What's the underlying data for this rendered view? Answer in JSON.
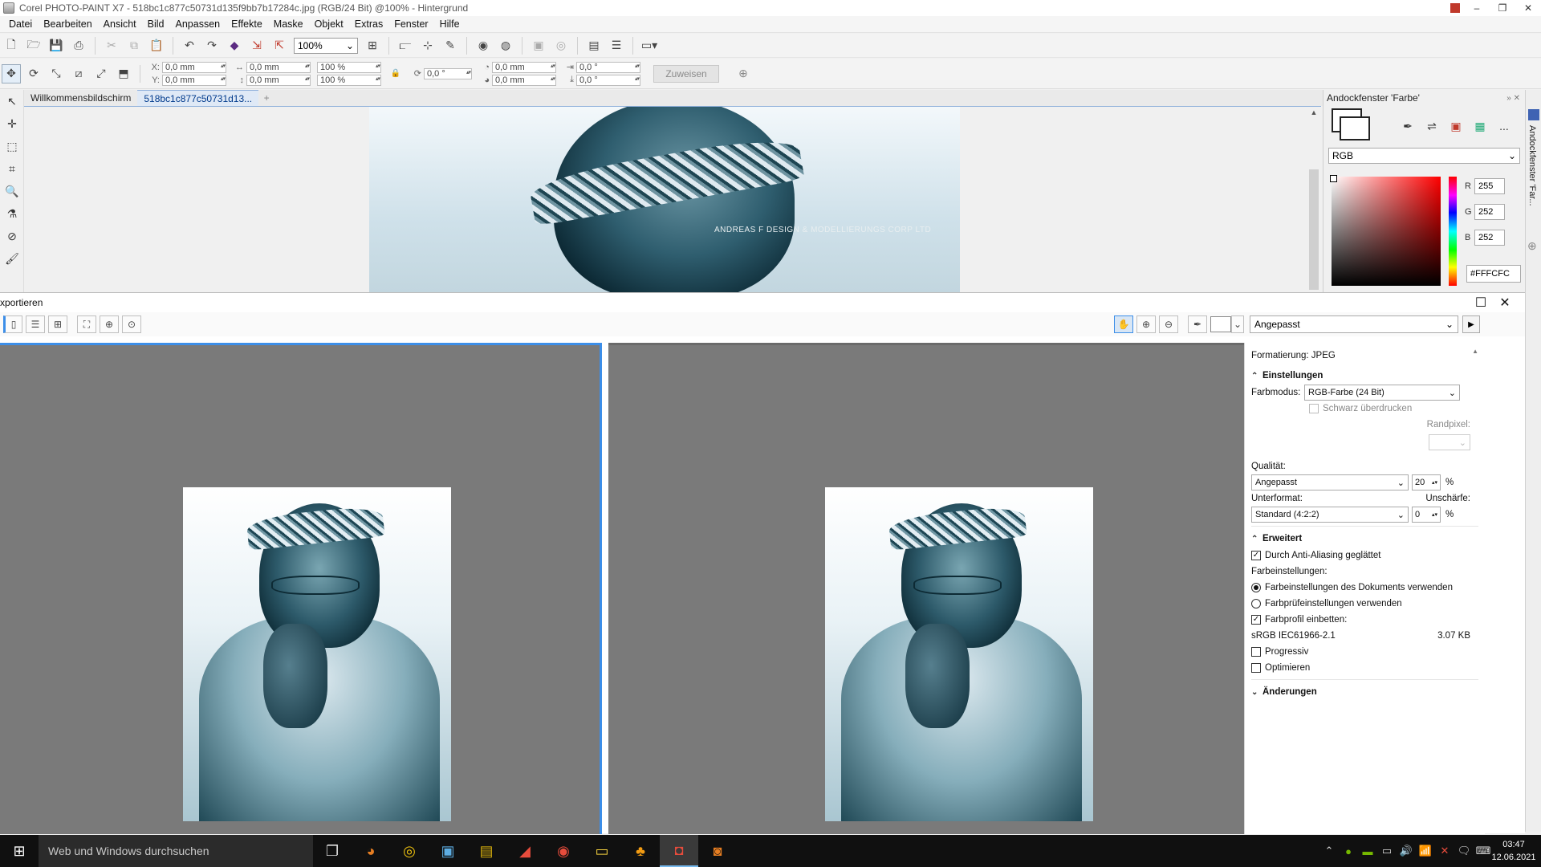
{
  "window": {
    "title": "Corel PHOTO-PAINT X7 - 518bc1c877c50731d135f9bb7b17284c.jpg (RGB/24 Bit) @100% - Hintergrund",
    "controls": {
      "minimize": "–",
      "restore": "❐",
      "close": "✕"
    }
  },
  "menu": [
    "Datei",
    "Bearbeiten",
    "Ansicht",
    "Bild",
    "Anpassen",
    "Effekte",
    "Maske",
    "Objekt",
    "Extras",
    "Fenster",
    "Hilfe"
  ],
  "toolbar": {
    "zoom": "100%",
    "fields": {
      "x_label": "X:",
      "x": "0,0 mm",
      "y_label": "Y:",
      "y": "0,0 mm",
      "w": "0,0 mm",
      "h": "0,0 mm",
      "scale_x": "100 %",
      "scale_y": "100 %",
      "rotate": "0,0 °",
      "center_x": "0,0 mm",
      "center_y": "0,0 mm",
      "skew_x": "0,0 °",
      "skew_y": "0,0 °"
    },
    "assign_label": "Zuweisen"
  },
  "tabs": {
    "welcome": "Willkommensbildschirm",
    "document": "518bc1c877c50731d13...",
    "add": "+"
  },
  "canvas": {
    "watermark": "ANDREAS F DESIGN & MODELLIERUNGS CORP LTD"
  },
  "docker": {
    "title": "Andockfenster 'Farbe'",
    "more": "...",
    "color_model": "RGB",
    "r_label": "R",
    "r": "255",
    "g_label": "G",
    "g": "252",
    "b_label": "B",
    "b": "252",
    "hex": "#FFFCFC",
    "vertical_tab": "Andockfenster 'Far..."
  },
  "export": {
    "title": "xportieren",
    "preset": "Angepasst",
    "format_label": "Formatierung: JPEG",
    "settings_header": "Einstellungen",
    "color_mode_label": "Farbmodus:",
    "color_mode": "RGB-Farbe (24 Bit)",
    "overprint_black": "Schwarz überdrucken",
    "border_pixel_label": "Randpixel:",
    "quality_label": "Qualität:",
    "quality_preset": "Angepasst",
    "quality_value": "20",
    "percent": "%",
    "subformat_label": "Unterformat:",
    "subformat": "Standard (4:2:2)",
    "blur_label": "Unschärfe:",
    "blur_value": "0",
    "advanced_header": "Erweitert",
    "antialias": "Durch Anti-Aliasing geglättet",
    "color_settings_label": "Farbeinstellungen:",
    "use_doc_settings": "Farbeinstellungen des Dokuments verwenden",
    "use_proof_settings": "Farbprüfeinstellungen verwenden",
    "embed_profile": "Farbprofil einbetten:",
    "profile_name": "sRGB IEC61966-2.1",
    "file_size": "3.07 KB",
    "progressive": "Progressiv",
    "optimize": "Optimieren",
    "changes_header": "Änderungen"
  },
  "taskbar": {
    "search_placeholder": "Web und Windows durchsuchen",
    "time": "03:47",
    "date": "12.06.2021"
  },
  "colors": {
    "accent_blue": "#3c8ee8",
    "preview_bg": "#7a7a7a",
    "taskbar_bg": "#101010"
  }
}
